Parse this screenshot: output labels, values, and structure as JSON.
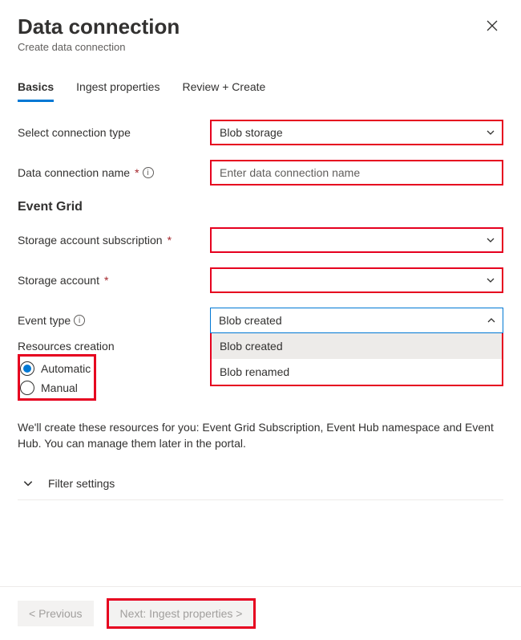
{
  "header": {
    "title": "Data connection",
    "subtitle": "Create data connection"
  },
  "tabs": {
    "basics": "Basics",
    "ingest": "Ingest properties",
    "review": "Review + Create"
  },
  "form": {
    "connection_type_label": "Select connection type",
    "connection_type_value": "Blob storage",
    "name_label": "Data connection name",
    "name_placeholder": "Enter data connection name",
    "event_grid_heading": "Event Grid",
    "subscription_label": "Storage account subscription",
    "subscription_value": "",
    "account_label": "Storage account",
    "account_value": "",
    "event_type_label": "Event type",
    "event_type_value": "Blob created",
    "event_type_options": {
      "opt1": "Blob created",
      "opt2": "Blob renamed"
    },
    "resources_label": "Resources creation",
    "resources_options": {
      "automatic": "Automatic",
      "manual": "Manual"
    },
    "description": "We'll create these resources for you: Event Grid Subscription, Event Hub namespace and Event Hub. You can manage them later in the portal.",
    "filter_settings": "Filter settings"
  },
  "footer": {
    "previous": "< Previous",
    "next": "Next: Ingest properties >"
  }
}
